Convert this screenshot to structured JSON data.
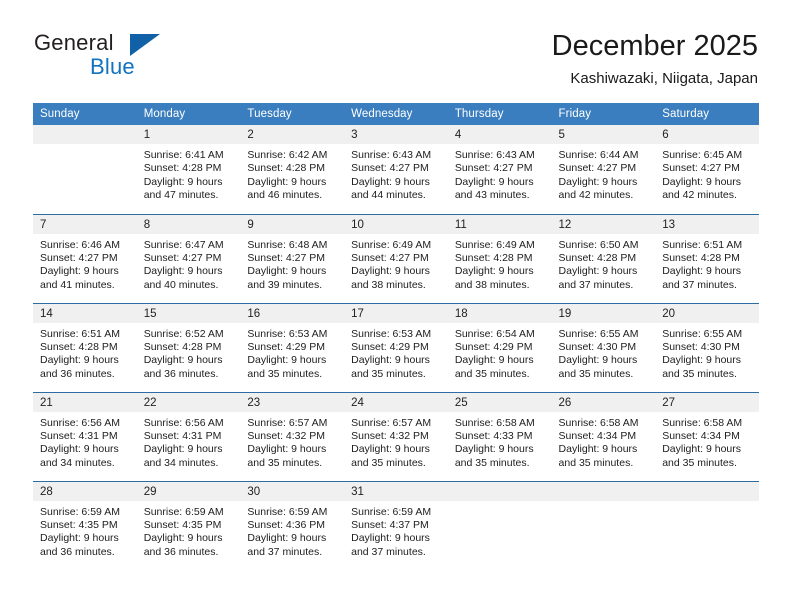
{
  "brand": {
    "name_part1": "General",
    "name_part2": "Blue",
    "logo_icon": "triangle-logo-icon"
  },
  "header": {
    "title": "December 2025",
    "subtitle": "Kashiwazaki, Niigata, Japan"
  },
  "calendar": {
    "weekday_headers": [
      "Sunday",
      "Monday",
      "Tuesday",
      "Wednesday",
      "Thursday",
      "Friday",
      "Saturday"
    ],
    "accent_color": "#3a7ebf",
    "separator_color": "#2e6da4",
    "daynum_band_color": "#f0f0f0",
    "weeks": [
      [
        {
          "day": "",
          "empty": true,
          "sunrise": "",
          "sunset": "",
          "daylight1": "",
          "daylight2": ""
        },
        {
          "day": "1",
          "empty": false,
          "sunrise": "Sunrise: 6:41 AM",
          "sunset": "Sunset: 4:28 PM",
          "daylight1": "Daylight: 9 hours",
          "daylight2": "and 47 minutes."
        },
        {
          "day": "2",
          "empty": false,
          "sunrise": "Sunrise: 6:42 AM",
          "sunset": "Sunset: 4:28 PM",
          "daylight1": "Daylight: 9 hours",
          "daylight2": "and 46 minutes."
        },
        {
          "day": "3",
          "empty": false,
          "sunrise": "Sunrise: 6:43 AM",
          "sunset": "Sunset: 4:27 PM",
          "daylight1": "Daylight: 9 hours",
          "daylight2": "and 44 minutes."
        },
        {
          "day": "4",
          "empty": false,
          "sunrise": "Sunrise: 6:43 AM",
          "sunset": "Sunset: 4:27 PM",
          "daylight1": "Daylight: 9 hours",
          "daylight2": "and 43 minutes."
        },
        {
          "day": "5",
          "empty": false,
          "sunrise": "Sunrise: 6:44 AM",
          "sunset": "Sunset: 4:27 PM",
          "daylight1": "Daylight: 9 hours",
          "daylight2": "and 42 minutes."
        },
        {
          "day": "6",
          "empty": false,
          "sunrise": "Sunrise: 6:45 AM",
          "sunset": "Sunset: 4:27 PM",
          "daylight1": "Daylight: 9 hours",
          "daylight2": "and 42 minutes."
        }
      ],
      [
        {
          "day": "7",
          "empty": false,
          "sunrise": "Sunrise: 6:46 AM",
          "sunset": "Sunset: 4:27 PM",
          "daylight1": "Daylight: 9 hours",
          "daylight2": "and 41 minutes."
        },
        {
          "day": "8",
          "empty": false,
          "sunrise": "Sunrise: 6:47 AM",
          "sunset": "Sunset: 4:27 PM",
          "daylight1": "Daylight: 9 hours",
          "daylight2": "and 40 minutes."
        },
        {
          "day": "9",
          "empty": false,
          "sunrise": "Sunrise: 6:48 AM",
          "sunset": "Sunset: 4:27 PM",
          "daylight1": "Daylight: 9 hours",
          "daylight2": "and 39 minutes."
        },
        {
          "day": "10",
          "empty": false,
          "sunrise": "Sunrise: 6:49 AM",
          "sunset": "Sunset: 4:27 PM",
          "daylight1": "Daylight: 9 hours",
          "daylight2": "and 38 minutes."
        },
        {
          "day": "11",
          "empty": false,
          "sunrise": "Sunrise: 6:49 AM",
          "sunset": "Sunset: 4:28 PM",
          "daylight1": "Daylight: 9 hours",
          "daylight2": "and 38 minutes."
        },
        {
          "day": "12",
          "empty": false,
          "sunrise": "Sunrise: 6:50 AM",
          "sunset": "Sunset: 4:28 PM",
          "daylight1": "Daylight: 9 hours",
          "daylight2": "and 37 minutes."
        },
        {
          "day": "13",
          "empty": false,
          "sunrise": "Sunrise: 6:51 AM",
          "sunset": "Sunset: 4:28 PM",
          "daylight1": "Daylight: 9 hours",
          "daylight2": "and 37 minutes."
        }
      ],
      [
        {
          "day": "14",
          "empty": false,
          "sunrise": "Sunrise: 6:51 AM",
          "sunset": "Sunset: 4:28 PM",
          "daylight1": "Daylight: 9 hours",
          "daylight2": "and 36 minutes."
        },
        {
          "day": "15",
          "empty": false,
          "sunrise": "Sunrise: 6:52 AM",
          "sunset": "Sunset: 4:28 PM",
          "daylight1": "Daylight: 9 hours",
          "daylight2": "and 36 minutes."
        },
        {
          "day": "16",
          "empty": false,
          "sunrise": "Sunrise: 6:53 AM",
          "sunset": "Sunset: 4:29 PM",
          "daylight1": "Daylight: 9 hours",
          "daylight2": "and 35 minutes."
        },
        {
          "day": "17",
          "empty": false,
          "sunrise": "Sunrise: 6:53 AM",
          "sunset": "Sunset: 4:29 PM",
          "daylight1": "Daylight: 9 hours",
          "daylight2": "and 35 minutes."
        },
        {
          "day": "18",
          "empty": false,
          "sunrise": "Sunrise: 6:54 AM",
          "sunset": "Sunset: 4:29 PM",
          "daylight1": "Daylight: 9 hours",
          "daylight2": "and 35 minutes."
        },
        {
          "day": "19",
          "empty": false,
          "sunrise": "Sunrise: 6:55 AM",
          "sunset": "Sunset: 4:30 PM",
          "daylight1": "Daylight: 9 hours",
          "daylight2": "and 35 minutes."
        },
        {
          "day": "20",
          "empty": false,
          "sunrise": "Sunrise: 6:55 AM",
          "sunset": "Sunset: 4:30 PM",
          "daylight1": "Daylight: 9 hours",
          "daylight2": "and 35 minutes."
        }
      ],
      [
        {
          "day": "21",
          "empty": false,
          "sunrise": "Sunrise: 6:56 AM",
          "sunset": "Sunset: 4:31 PM",
          "daylight1": "Daylight: 9 hours",
          "daylight2": "and 34 minutes."
        },
        {
          "day": "22",
          "empty": false,
          "sunrise": "Sunrise: 6:56 AM",
          "sunset": "Sunset: 4:31 PM",
          "daylight1": "Daylight: 9 hours",
          "daylight2": "and 34 minutes."
        },
        {
          "day": "23",
          "empty": false,
          "sunrise": "Sunrise: 6:57 AM",
          "sunset": "Sunset: 4:32 PM",
          "daylight1": "Daylight: 9 hours",
          "daylight2": "and 35 minutes."
        },
        {
          "day": "24",
          "empty": false,
          "sunrise": "Sunrise: 6:57 AM",
          "sunset": "Sunset: 4:32 PM",
          "daylight1": "Daylight: 9 hours",
          "daylight2": "and 35 minutes."
        },
        {
          "day": "25",
          "empty": false,
          "sunrise": "Sunrise: 6:58 AM",
          "sunset": "Sunset: 4:33 PM",
          "daylight1": "Daylight: 9 hours",
          "daylight2": "and 35 minutes."
        },
        {
          "day": "26",
          "empty": false,
          "sunrise": "Sunrise: 6:58 AM",
          "sunset": "Sunset: 4:34 PM",
          "daylight1": "Daylight: 9 hours",
          "daylight2": "and 35 minutes."
        },
        {
          "day": "27",
          "empty": false,
          "sunrise": "Sunrise: 6:58 AM",
          "sunset": "Sunset: 4:34 PM",
          "daylight1": "Daylight: 9 hours",
          "daylight2": "and 35 minutes."
        }
      ],
      [
        {
          "day": "28",
          "empty": false,
          "sunrise": "Sunrise: 6:59 AM",
          "sunset": "Sunset: 4:35 PM",
          "daylight1": "Daylight: 9 hours",
          "daylight2": "and 36 minutes."
        },
        {
          "day": "29",
          "empty": false,
          "sunrise": "Sunrise: 6:59 AM",
          "sunset": "Sunset: 4:35 PM",
          "daylight1": "Daylight: 9 hours",
          "daylight2": "and 36 minutes."
        },
        {
          "day": "30",
          "empty": false,
          "sunrise": "Sunrise: 6:59 AM",
          "sunset": "Sunset: 4:36 PM",
          "daylight1": "Daylight: 9 hours",
          "daylight2": "and 37 minutes."
        },
        {
          "day": "31",
          "empty": false,
          "sunrise": "Sunrise: 6:59 AM",
          "sunset": "Sunset: 4:37 PM",
          "daylight1": "Daylight: 9 hours",
          "daylight2": "and 37 minutes."
        },
        {
          "day": "",
          "empty": true,
          "sunrise": "",
          "sunset": "",
          "daylight1": "",
          "daylight2": ""
        },
        {
          "day": "",
          "empty": true,
          "sunrise": "",
          "sunset": "",
          "daylight1": "",
          "daylight2": ""
        },
        {
          "day": "",
          "empty": true,
          "sunrise": "",
          "sunset": "",
          "daylight1": "",
          "daylight2": ""
        }
      ]
    ]
  }
}
